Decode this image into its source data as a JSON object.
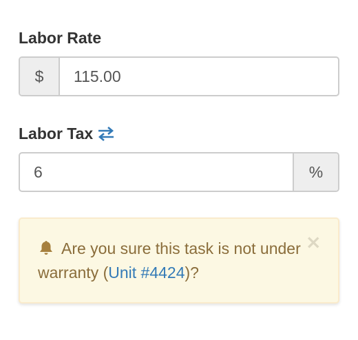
{
  "labor_rate": {
    "label": "Labor Rate",
    "prefix": "$",
    "value": "115.00"
  },
  "labor_tax": {
    "label": "Labor Tax",
    "value": "6",
    "suffix": "%",
    "toggle_icon": "swap-arrows-icon"
  },
  "alert": {
    "icon": "bell-icon",
    "text_before": "Are you sure this task is not under warranty (",
    "link_text": "Unit #4424",
    "text_after": ")?",
    "close_symbol": "×"
  },
  "colors": {
    "link": "#337ab7",
    "alert_bg": "#fcf8e3",
    "alert_text": "#8a6d3b",
    "alert_border": "#faebcc"
  }
}
